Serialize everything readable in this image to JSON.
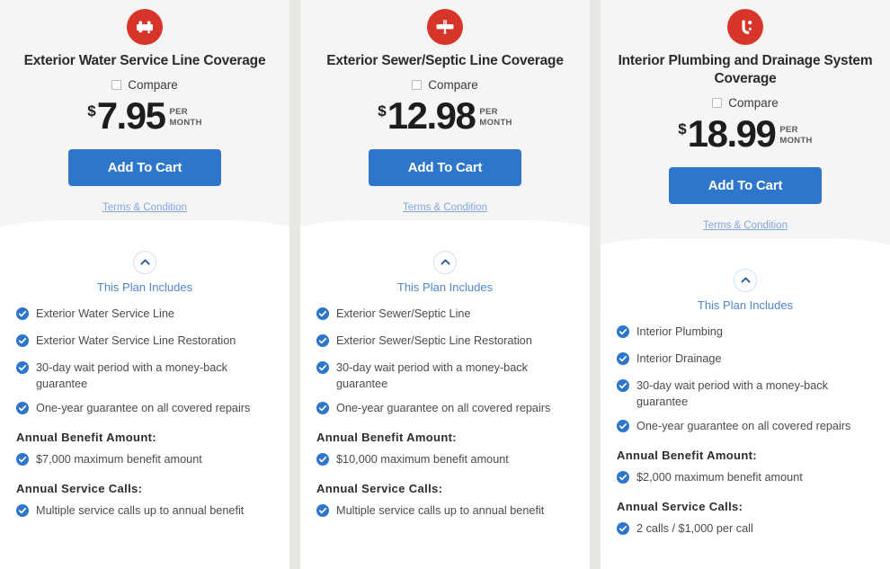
{
  "theme": {
    "page_background": "#e9e7e2",
    "card_background": "#ffffff",
    "header_background": "#f6f5f3",
    "icon_circle_color": "#d8352a",
    "button_color": "#2e75cc",
    "check_color": "#2e75cc",
    "link_color": "#7fa8dd",
    "includes_link_color": "#4e86c9"
  },
  "common": {
    "compare_label": "Compare",
    "add_to_cart_label": "Add To Cart",
    "terms_label": "Terms & Condition",
    "includes_label": "This Plan Includes",
    "currency_symbol": "$",
    "period_line_1": "PER",
    "period_line_2": "MONTH",
    "annual_benefit_heading": "Annual Benefit Amount:",
    "annual_service_heading": "Annual Service Calls:",
    "toggle_icon": "chevron-up-icon",
    "check_icon": "check-circle-icon",
    "compare_checkbox_checked": false
  },
  "plans": [
    {
      "icon_name": "water-pipe-icon",
      "title": "Exterior Water Service Line Coverage",
      "price": "7.95",
      "features": [
        "Exterior Water Service Line",
        "Exterior Water Service Line Restoration",
        "30-day wait period with a money-back guarantee",
        "One-year guarantee on all covered repairs"
      ],
      "annual_benefit": "$7,000 maximum benefit amount",
      "annual_service": "Multiple service calls up to annual benefit"
    },
    {
      "icon_name": "sewer-pipe-icon",
      "title": "Exterior Sewer/Septic Line Coverage",
      "price": "12.98",
      "features": [
        "Exterior Sewer/Septic Line",
        "Exterior Sewer/Septic Line Restoration",
        "30-day wait period with a money-back guarantee",
        "One-year guarantee on all covered repairs"
      ],
      "annual_benefit": "$10,000 maximum benefit amount",
      "annual_service": "Multiple service calls up to annual benefit"
    },
    {
      "icon_name": "faucet-drip-icon",
      "title": "Interior Plumbing and Drainage System Coverage",
      "price": "18.99",
      "features": [
        "Interior Plumbing",
        "Interior Drainage",
        "30-day wait period with a money-back guarantee",
        "One-year guarantee on all covered repairs"
      ],
      "annual_benefit": "$2,000 maximum benefit amount",
      "annual_service": "2 calls / $1,000 per call"
    }
  ]
}
